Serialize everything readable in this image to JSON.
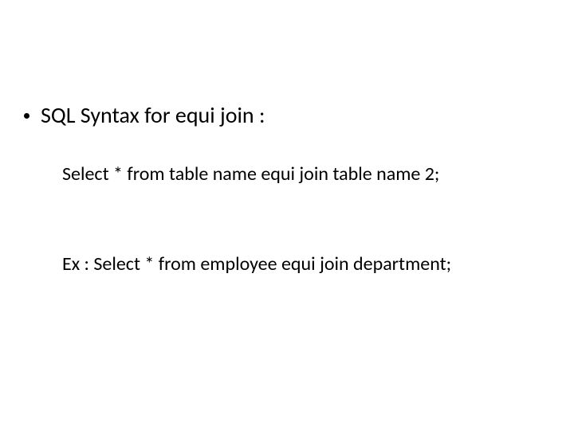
{
  "slide": {
    "bullet": "SQL Syntax for equi join :",
    "syntax_line": "Select * from table name equi join table name 2;",
    "example_line": "Ex : Select * from employee equi join department;"
  }
}
